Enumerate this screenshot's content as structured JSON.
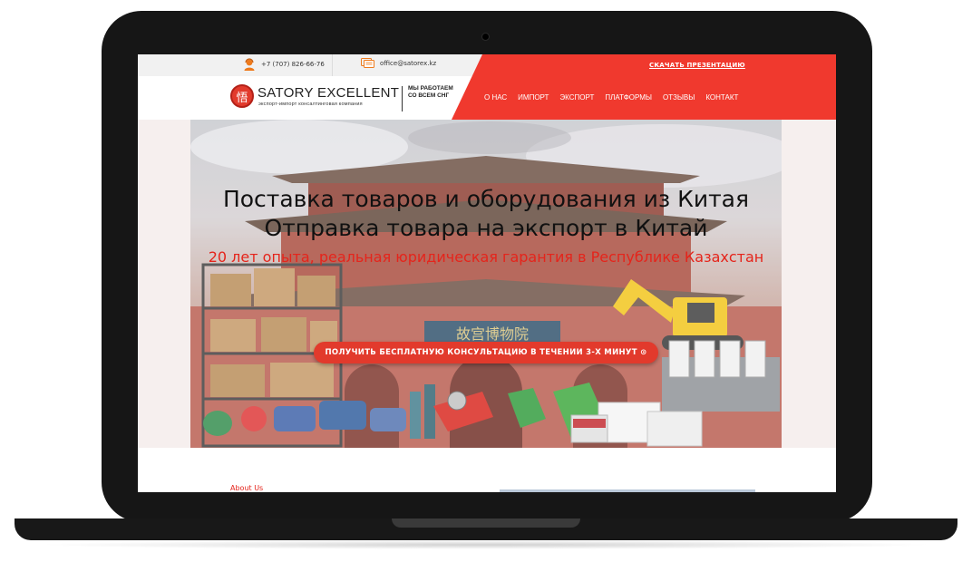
{
  "topbar": {
    "phone": "+7 (707) 826-66-76",
    "email": "office@satorex.kz",
    "presentation_link": "СКАЧАТЬ ПРЕЗЕНТАЦИЮ"
  },
  "logo": {
    "emblem_char": "悟",
    "title": "SATORY EXCELLENT",
    "subtitle": "экспорт-импорт консалтинговая компания",
    "tagline": "МЫ РАБОТАЕМ СО ВСЕМ СНГ"
  },
  "nav": {
    "items": [
      {
        "label": "О НАС"
      },
      {
        "label": "ИМПОРТ"
      },
      {
        "label": "ЭКСПОРТ"
      },
      {
        "label": "ПЛАТФОРМЫ"
      },
      {
        "label": "ОТЗЫВЫ"
      },
      {
        "label": "КОНТАКТ"
      }
    ]
  },
  "hero": {
    "headline_1": "Поставка товаров и оборудования из Китая",
    "headline_2": "Отправка товара на экспорт в Китай",
    "subheadline": "20 лет опыта, реальная юридическая гарантия в Республике Казахстан",
    "cta_label": "ПОЛУЧИТЬ БЕСПЛАТНУЮ КОНСУЛЬТАЦИЮ В ТЕЧЕНИИ 3-Х МИНУТ ⊙"
  },
  "about": {
    "label": "About Us"
  },
  "colors": {
    "accent_red": "#f0392e",
    "text_red": "#e5241b",
    "frame": "#161616"
  },
  "icons": [
    "headset-icon",
    "mail-icon",
    "logo-emblem"
  ]
}
